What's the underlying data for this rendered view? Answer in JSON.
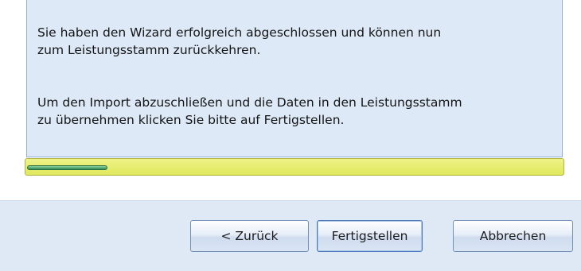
{
  "info": {
    "paragraph1": "Sie haben den Wizard erfolgreich abgeschlossen und können nun\nzum Leistungsstamm zurückkehren.",
    "paragraph2": "Um den Import abzuschließen und die Daten in den Leistungsstamm\nzu übernehmen klicken Sie bitte auf Fertigstellen."
  },
  "progress": {
    "fraction": 0.15
  },
  "buttons": {
    "back_label": "< Zurück",
    "finish_label": "Fertigstellen",
    "cancel_label": "Abbrechen"
  }
}
